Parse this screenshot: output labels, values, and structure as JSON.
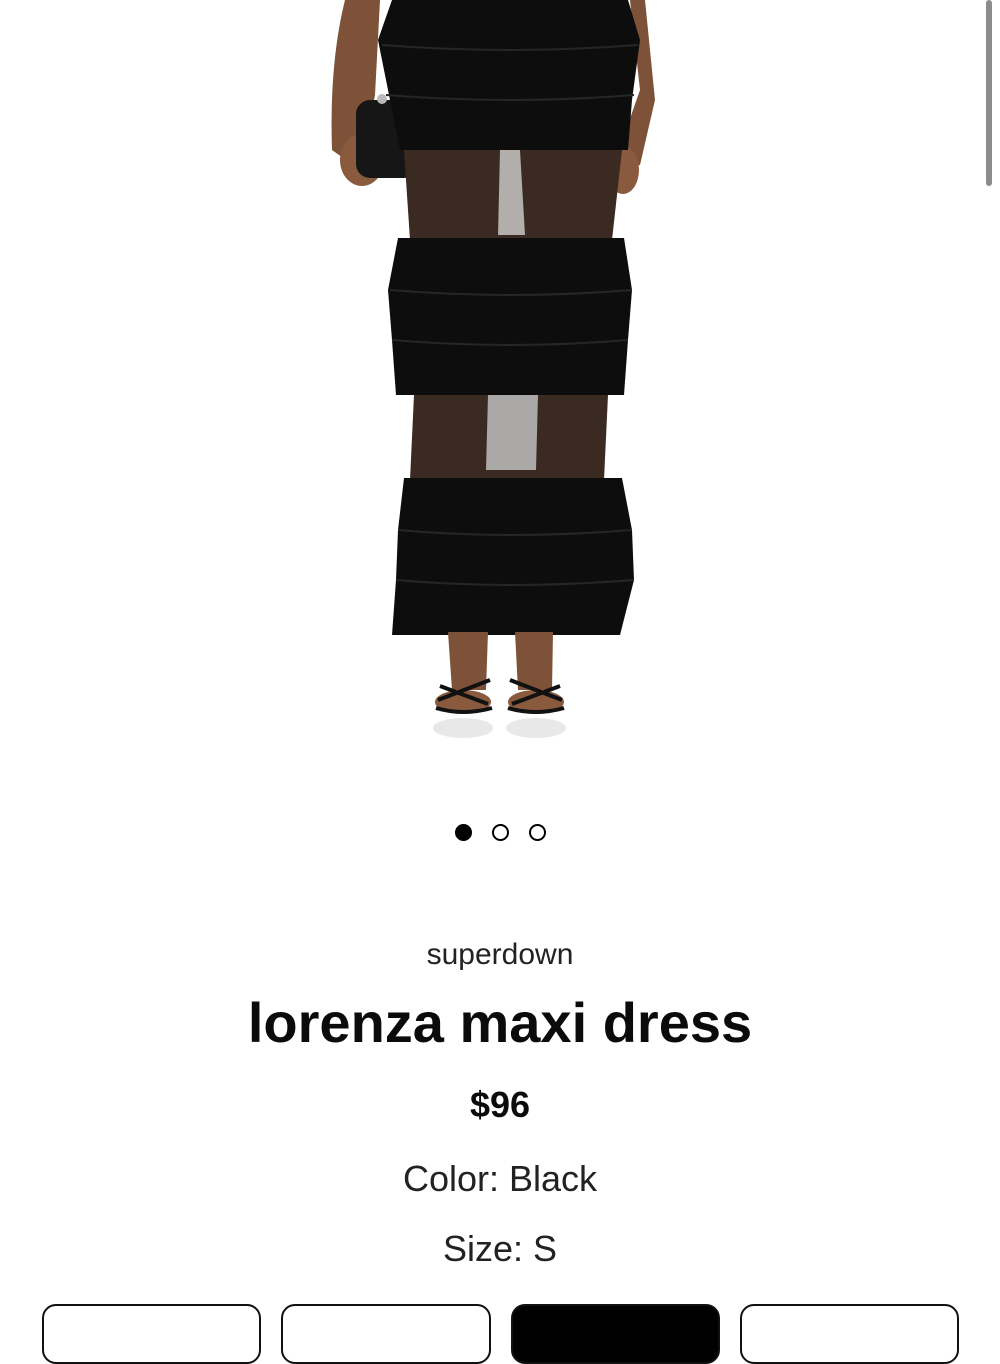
{
  "product": {
    "brand": "superdown",
    "title": "lorenza maxi dress",
    "price": "$96",
    "color_label": "Color: Black",
    "size_label": "Size: S",
    "colors": {
      "dress": "#0d0d0d",
      "sheer": "#3a2a22",
      "skin": "#8a5a3f",
      "background": "#ffffff"
    }
  },
  "gallery": {
    "total_images": 3,
    "active_index": 0
  },
  "sizes": [
    {
      "label": "",
      "selected": false
    },
    {
      "label": "",
      "selected": false
    },
    {
      "label": "",
      "selected": true
    },
    {
      "label": "",
      "selected": false
    }
  ]
}
